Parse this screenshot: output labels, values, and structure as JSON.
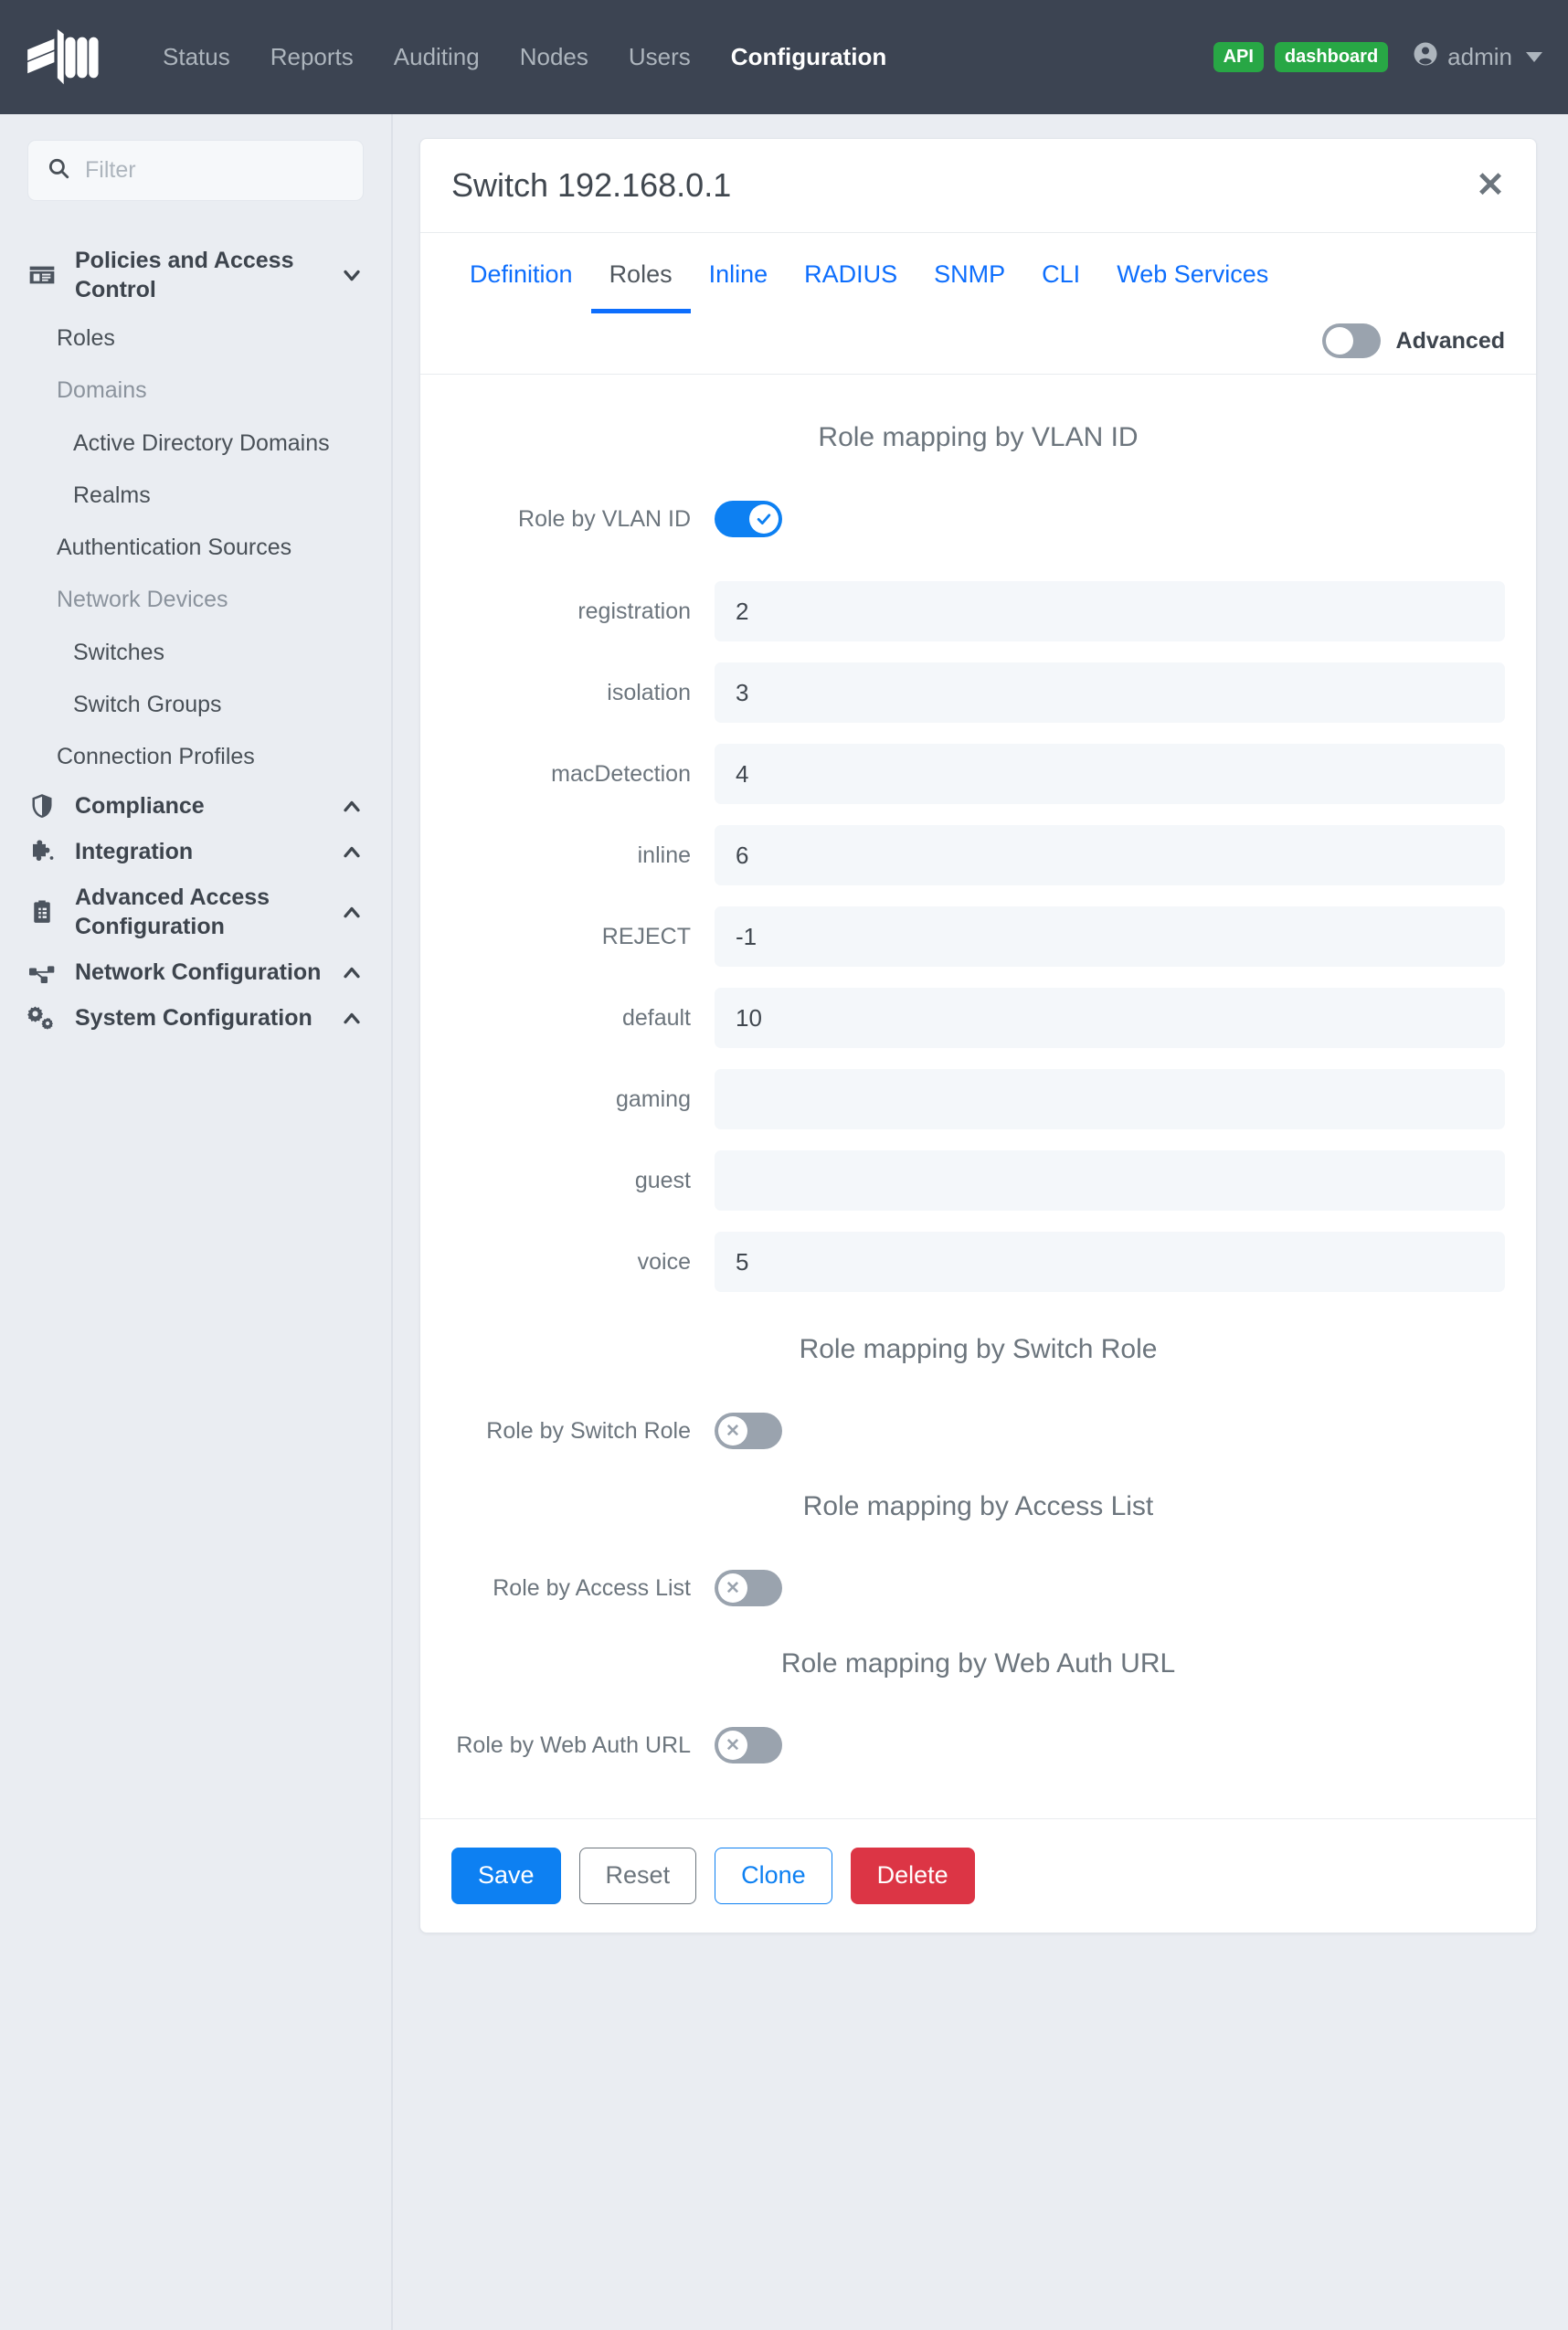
{
  "navbar": {
    "logo_icon": "packetfence-logo-icon",
    "links": [
      {
        "label": "Status",
        "active": false
      },
      {
        "label": "Reports",
        "active": false
      },
      {
        "label": "Auditing",
        "active": false
      },
      {
        "label": "Nodes",
        "active": false
      },
      {
        "label": "Users",
        "active": false
      },
      {
        "label": "Configuration",
        "active": true
      }
    ],
    "badges": [
      {
        "label": "API",
        "color": "#28a745"
      },
      {
        "label": "dashboard",
        "color": "#28a745"
      }
    ],
    "user": "admin",
    "user_icon": "account-circle-icon",
    "caret_icon": "chevron-down-icon",
    "background": "#3c4452"
  },
  "sidebar": {
    "filter": {
      "value": "",
      "placeholder": "Filter",
      "icon": "search-icon"
    },
    "entries": [
      {
        "type": "group",
        "label": "Policies and Access Control",
        "icon": "id-card-icon",
        "chevron": "chevron-down-icon",
        "expanded": true
      },
      {
        "type": "item",
        "label": "Roles"
      },
      {
        "type": "sublabel",
        "label": "Domains"
      },
      {
        "type": "subitem",
        "label": "Active Directory Domains"
      },
      {
        "type": "subitem",
        "label": "Realms"
      },
      {
        "type": "item",
        "label": "Authentication Sources"
      },
      {
        "type": "sublabel",
        "label": "Network Devices"
      },
      {
        "type": "subitem",
        "label": "Switches"
      },
      {
        "type": "subitem",
        "label": "Switch Groups"
      },
      {
        "type": "item",
        "label": "Connection Profiles"
      },
      {
        "type": "group",
        "label": "Compliance",
        "icon": "shield-icon",
        "chevron": "chevron-up-icon",
        "expanded": false
      },
      {
        "type": "group",
        "label": "Integration",
        "icon": "puzzle-piece-icon",
        "chevron": "chevron-up-icon",
        "expanded": false
      },
      {
        "type": "group",
        "label": "Advanced Access Configuration",
        "icon": "clipboard-list-icon",
        "chevron": "chevron-up-icon",
        "expanded": false
      },
      {
        "type": "group",
        "label": "Network Configuration",
        "icon": "network-topology-icon",
        "chevron": "chevron-up-icon",
        "expanded": false
      },
      {
        "type": "group",
        "label": "System Configuration",
        "icon": "gears-icon",
        "chevron": "chevron-up-icon",
        "expanded": false
      }
    ]
  },
  "card": {
    "title": "Switch 192.168.0.1",
    "close_icon": "close-icon",
    "tabs": [
      {
        "label": "Definition",
        "active": false
      },
      {
        "label": "Roles",
        "active": true
      },
      {
        "label": "Inline",
        "active": false
      },
      {
        "label": "RADIUS",
        "active": false
      },
      {
        "label": "SNMP",
        "active": false
      },
      {
        "label": "CLI",
        "active": false
      },
      {
        "label": "Web Services",
        "active": false
      }
    ],
    "advanced": {
      "label": "Advanced",
      "on": false
    },
    "sections": [
      {
        "id": "vlan",
        "title": "Role mapping by VLAN ID",
        "toggle": {
          "label": "Role by VLAN ID",
          "on": true
        },
        "fields": [
          {
            "label": "registration",
            "value": "2"
          },
          {
            "label": "isolation",
            "value": "3"
          },
          {
            "label": "macDetection",
            "value": "4"
          },
          {
            "label": "inline",
            "value": "6"
          },
          {
            "label": "REJECT",
            "value": "-1"
          },
          {
            "label": "default",
            "value": "10"
          },
          {
            "label": "gaming",
            "value": ""
          },
          {
            "label": "guest",
            "value": ""
          },
          {
            "label": "voice",
            "value": "5"
          }
        ]
      },
      {
        "id": "switch-role",
        "title": "Role mapping by Switch Role",
        "toggle": {
          "label": "Role by Switch Role",
          "on": false
        },
        "fields": []
      },
      {
        "id": "access-list",
        "title": "Role mapping by Access List",
        "toggle": {
          "label": "Role by Access List",
          "on": false
        },
        "fields": []
      },
      {
        "id": "web-auth-url",
        "title": "Role mapping by Web Auth URL",
        "toggle": {
          "label": "Role by Web Auth URL",
          "on": false
        },
        "fields": []
      }
    ],
    "footer_buttons": [
      {
        "label": "Save",
        "style": "btn-save"
      },
      {
        "label": "Reset",
        "style": "btn-reset"
      },
      {
        "label": "Clone",
        "style": "btn-clone"
      },
      {
        "label": "Delete",
        "style": "btn-delete"
      }
    ]
  },
  "colors": {
    "accent": "#0d80f2",
    "link": "#0d6efd",
    "navbar_bg": "#3c4452",
    "danger": "#dc3545",
    "success": "#28a745",
    "page_bg": "#eaedf2"
  }
}
